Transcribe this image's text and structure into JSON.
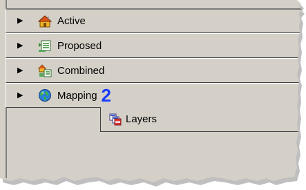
{
  "tree": {
    "items": [
      {
        "label": "Active",
        "icon": "house-icon"
      },
      {
        "label": "Proposed",
        "icon": "proposed-icon"
      },
      {
        "label": "Combined",
        "icon": "combined-icon"
      },
      {
        "label": "Mapping",
        "icon": "globe-icon",
        "badge": "2"
      }
    ],
    "child": {
      "label": "Layers",
      "icon": "layers-icon"
    }
  },
  "colors": {
    "panel": "#d4d0c8",
    "badge": "#1a3bff"
  }
}
